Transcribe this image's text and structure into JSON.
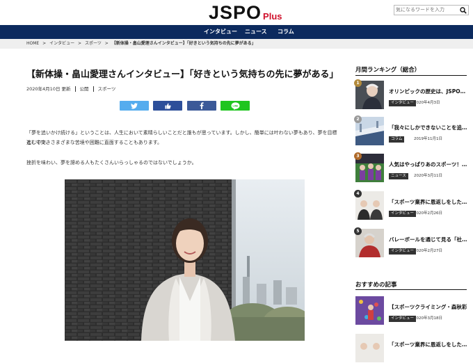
{
  "header": {
    "logo_main": "JSPO",
    "logo_plus": "Plus",
    "search_placeholder": "気になるワードを入力"
  },
  "nav": [
    "インタビュー",
    "ニュース",
    "コラム"
  ],
  "breadcrumb": [
    "HOME",
    ">",
    "インタビュー",
    ">",
    "スポーツ",
    ">",
    "【新体操・畠山愛理さんインタビュー】「好きという気持ちの先に夢がある」"
  ],
  "article": {
    "title": "【新体操・畠山愛理さんインタビュー】「好きという気持ちの先に夢がある」",
    "date": "2020年4月10日 更新",
    "status": "公開",
    "category": "スポーツ",
    "paragraphs": [
      "「夢を追いかけ続ける」ということは、人生において素晴らしいことだと誰もが思っています。しかし、簡単には叶わない夢もあり、夢を目標として突き",
      "進む中で、さまざまな苦境や困難に直面することもあります。",
      "挫折を味わい、夢を諦める人もたくさんいらっしゃるのではないでしょうか。"
    ]
  },
  "share": {
    "twitter_color": "#55acee",
    "like_color": "#2d4f9a",
    "facebook_color": "#3b5998",
    "line_color": "#1fc51f"
  },
  "ranking": {
    "heading": "月間ランキング（総合）",
    "items": [
      {
        "num": "1",
        "title": "オリンピックの歴史は、JSPO…",
        "badge": "インタビュー",
        "date": "2020年4月3日"
      },
      {
        "num": "2",
        "title": "「我々にしかできないことを追…",
        "badge": "コラム",
        "date": "2019年11月1日"
      },
      {
        "num": "3",
        "title": "人気はやっぱりあのスポーツ！…",
        "badge": "ニュース",
        "date": "2020年3月11日"
      },
      {
        "num": "4",
        "title": "「スポーツ業界に恩返しをした…",
        "badge": "インタビュー",
        "date": "2020年2月26日"
      },
      {
        "num": "5",
        "title": "バレーボールを通じて見る「社…",
        "badge": "インタビュー",
        "date": "2020年2月27日"
      }
    ]
  },
  "recommend": {
    "heading": "おすすめの記事",
    "items": [
      {
        "title": "【スポーツクライミング・森秋彩…",
        "badge": "インタビュー",
        "date": "2020年3月18日"
      },
      {
        "title": "「スポーツ業界に恩返しをした…"
      }
    ]
  }
}
